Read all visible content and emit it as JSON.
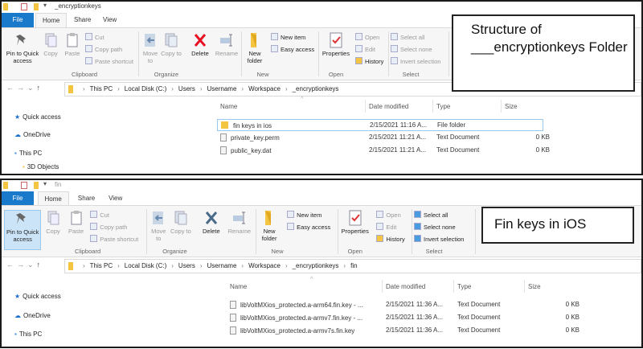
{
  "panels": [
    {
      "title": "_encryptionkeys",
      "tabs": [
        "File",
        "Home",
        "Share",
        "View"
      ],
      "ribbon": {
        "pin": "Pin to Quick access",
        "copy": "Copy",
        "paste": "Paste",
        "cut": "Cut",
        "copy_path": "Copy path",
        "paste_shortcut": "Paste shortcut",
        "move_to": "Move to",
        "copy_to": "Copy to",
        "delete": "Delete",
        "rename": "Rename",
        "new_folder": "New folder",
        "new_item": "New item",
        "easy_access": "Easy access",
        "properties": "Properties",
        "open": "Open",
        "edit": "Edit",
        "history": "History",
        "select_all": "Select all",
        "select_none": "Select none",
        "invert_selection": "Invert selection",
        "groups": [
          "Clipboard",
          "Organize",
          "New",
          "Open",
          "Select"
        ]
      },
      "breadcrumb": [
        "This PC",
        "Local Disk (C:)",
        "Users",
        "Username",
        "Workspace",
        "_encryptionkeys"
      ],
      "nav": [
        "Quick access",
        "OneDrive",
        "This PC",
        "3D Objects"
      ],
      "columns": [
        "Name",
        "Date modified",
        "Type",
        "Size"
      ],
      "rows": [
        {
          "name": "fin keys in ios",
          "date": "2/15/2021 11:16 A...",
          "type": "File folder",
          "size": "",
          "kind": "folder"
        },
        {
          "name": "private_key.perm",
          "date": "2/15/2021 11:21 A...",
          "type": "Text Document",
          "size": "0 KB",
          "kind": "file"
        },
        {
          "name": "public_key.dat",
          "date": "2/15/2021 11:21 A...",
          "type": "Text Document",
          "size": "0 KB",
          "kind": "file"
        }
      ],
      "callout": "Structure of ___encryptionkeys Folder"
    },
    {
      "title": "fin",
      "tabs": [
        "File",
        "Home",
        "Share",
        "View"
      ],
      "ribbon": {
        "pin": "Pin to Quick access",
        "copy": "Copy",
        "paste": "Paste",
        "cut": "Cut",
        "copy_path": "Copy path",
        "paste_shortcut": "Paste shortcut",
        "move_to": "Move to",
        "copy_to": "Copy to",
        "delete": "Delete",
        "rename": "Rename",
        "new_folder": "New folder",
        "new_item": "New item",
        "easy_access": "Easy access",
        "properties": "Properties",
        "open": "Open",
        "edit": "Edit",
        "history": "History",
        "select_all": "Select all",
        "select_none": "Select none",
        "invert_selection": "Invert selection",
        "groups": [
          "Clipboard",
          "Organize",
          "New",
          "Open",
          "Select"
        ]
      },
      "breadcrumb": [
        "This PC",
        "Local Disk (C:)",
        "Users",
        "Username",
        "Workspace",
        "_encryptionkeys",
        "fin"
      ],
      "nav": [
        "Quick access",
        "OneDrive",
        "This PC"
      ],
      "columns": [
        "Name",
        "Date modified",
        "Type",
        "Size"
      ],
      "rows": [
        {
          "name": "libVoltMXios_protected.a-arm64.fin.key - ...",
          "date": "2/15/2021 11:36 A...",
          "type": "Text Document",
          "size": "0 KB",
          "kind": "file"
        },
        {
          "name": "libVoltMXios_protected.a-armv7.fin.key - ...",
          "date": "2/15/2021 11:36 A...",
          "type": "Text Document",
          "size": "0 KB",
          "kind": "file"
        },
        {
          "name": "libVoltMXios_protected.a-armv7s.fin.key",
          "date": "2/15/2021 11:36 A...",
          "type": "Text Document",
          "size": "0 KB",
          "kind": "file"
        }
      ],
      "callout": "Fin keys in iOS"
    }
  ],
  "colors": {
    "file_tab": "#1979ca",
    "delete_top": "#e81123",
    "delete_bottom": "#4a6a8a",
    "folder": "#f4c542"
  }
}
